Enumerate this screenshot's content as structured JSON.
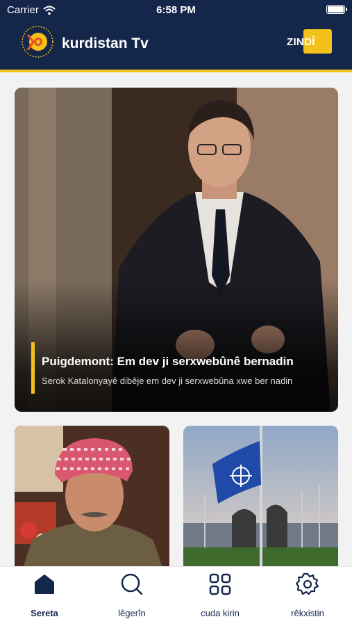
{
  "status_bar": {
    "carrier": "Carrier",
    "time": "6:58 PM"
  },
  "header": {
    "brand": "kurdistan Tv",
    "live_label": "ZINDÎ",
    "accent_color": "#f2c21a",
    "bg_color": "#14264a"
  },
  "hero": {
    "title": "Puigdemont: Em dev ji serxwebûnê bernadin",
    "subtitle": "Serok Katalonyayê dibêje em dev ji serxwebûna xwe ber nadin"
  },
  "tabs": [
    {
      "label": "Sereta",
      "icon": "home-icon",
      "active": true
    },
    {
      "label": "lêgerîn",
      "icon": "search-icon",
      "active": false
    },
    {
      "label": "cuda kirin",
      "icon": "grid-icon",
      "active": false
    },
    {
      "label": "rêkxistin",
      "icon": "gear-icon",
      "active": false
    }
  ]
}
